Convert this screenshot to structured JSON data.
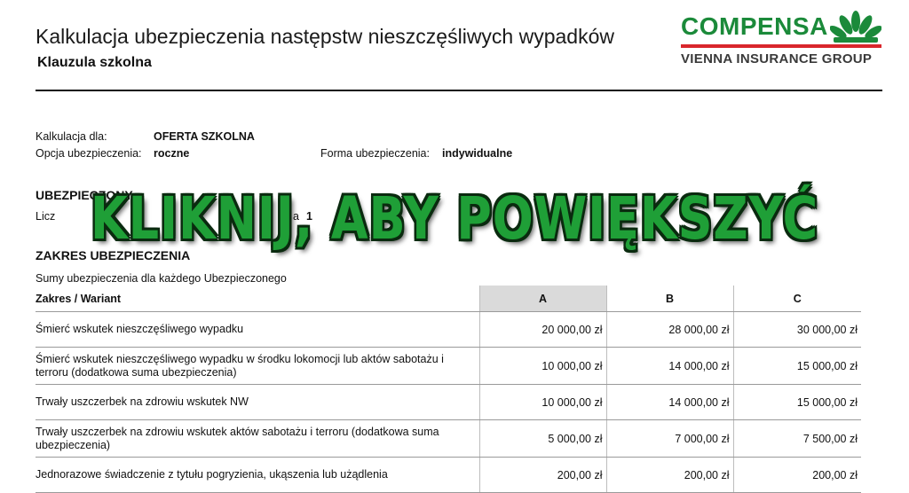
{
  "header": {
    "title": "Kalkulacja ubezpieczenia następstw nieszczęśliwych wypadków",
    "subtitle": "Klauzula szkolna"
  },
  "logo": {
    "brand": "COMPENSA",
    "group": "VIENNA INSURANCE GROUP",
    "brand_color": "#1b8a3a",
    "bar_color": "#d9262c"
  },
  "calculation": {
    "for_label": "Kalkulacja dla:",
    "for_value": "OFERTA SZKOLNA",
    "option_label": "Opcja ubezpieczenia:",
    "option_value": "roczne",
    "form_label": "Forma ubezpieczenia:",
    "form_value": "indywidualne"
  },
  "insured": {
    "heading": "UBEZPIECZONY",
    "count_label_left": "Licz",
    "count_label_mid": "a",
    "count_value": "1"
  },
  "scope": {
    "heading": "ZAKRES UBEZPIECZENIA",
    "note": "Sumy ubezpieczenia dla każdego Ubezpieczonego"
  },
  "overlay": {
    "text": "KLIKNIJ, ABY POWIĘKSZYĆ",
    "color": "#1f9f37"
  },
  "table": {
    "headers": [
      "Zakres / Wariant",
      "A",
      "B",
      "C"
    ],
    "rows": [
      {
        "label": "Śmierć wskutek nieszczęśliwego wypadku",
        "a": "20 000,00 zł",
        "b": "28 000,00 zł",
        "c": "30 000,00 zł"
      },
      {
        "label": "Śmierć wskutek nieszczęśliwego wypadku w środku lokomocji lub aktów sabotażu i terroru (dodatkowa suma ubezpieczenia)",
        "a": "10 000,00 zł",
        "b": "14 000,00 zł",
        "c": "15 000,00 zł"
      },
      {
        "label": "Trwały uszczerbek na zdrowiu wskutek NW",
        "a": "10 000,00 zł",
        "b": "14 000,00 zł",
        "c": "15 000,00 zł"
      },
      {
        "label": "Trwały uszczerbek na zdrowiu wskutek aktów sabotażu i terroru (dodatkowa suma ubezpieczenia)",
        "a": "5 000,00 zł",
        "b": "7 000,00 zł",
        "c": "7 500,00 zł"
      },
      {
        "label": "Jednorazowe świadczenie z tytułu pogryzienia, ukąszenia lub użądlenia",
        "a": "200,00 zł",
        "b": "200,00 zł",
        "c": "200,00 zł"
      }
    ]
  }
}
